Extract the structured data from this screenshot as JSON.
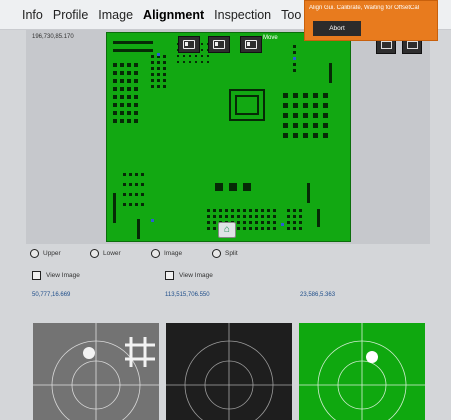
{
  "menu": {
    "items": [
      {
        "label": "Info"
      },
      {
        "label": "Profile"
      },
      {
        "label": "Image"
      },
      {
        "label": "Alignment"
      },
      {
        "label": "Inspection"
      },
      {
        "label": "Too"
      }
    ]
  },
  "notification": {
    "message": "Align Gui. Calibrate, Waiting for OffsetCal",
    "button_label": "Abort",
    "color": "#e87b1e"
  },
  "viewer": {
    "coordinate": "196,730,85.170",
    "move_label": "Move",
    "board_color": "#12a812"
  },
  "radios": [
    {
      "label": "Upper"
    },
    {
      "label": "Lower"
    },
    {
      "label": "Image"
    },
    {
      "label": "Split"
    }
  ],
  "checkboxes": [
    {
      "label": "View Image"
    },
    {
      "label": "View Image"
    }
  ],
  "coordinates": [
    {
      "text": "50,777,16.669"
    },
    {
      "text": "113,515,706.550"
    },
    {
      "text": "23,586,5.363"
    }
  ],
  "cameras": [
    {
      "name": "upper-camera",
      "background": "#6e6e6e"
    },
    {
      "name": "lower-camera",
      "background": "#1e1e1e"
    },
    {
      "name": "image-camera",
      "background": "#0fa80f"
    }
  ]
}
